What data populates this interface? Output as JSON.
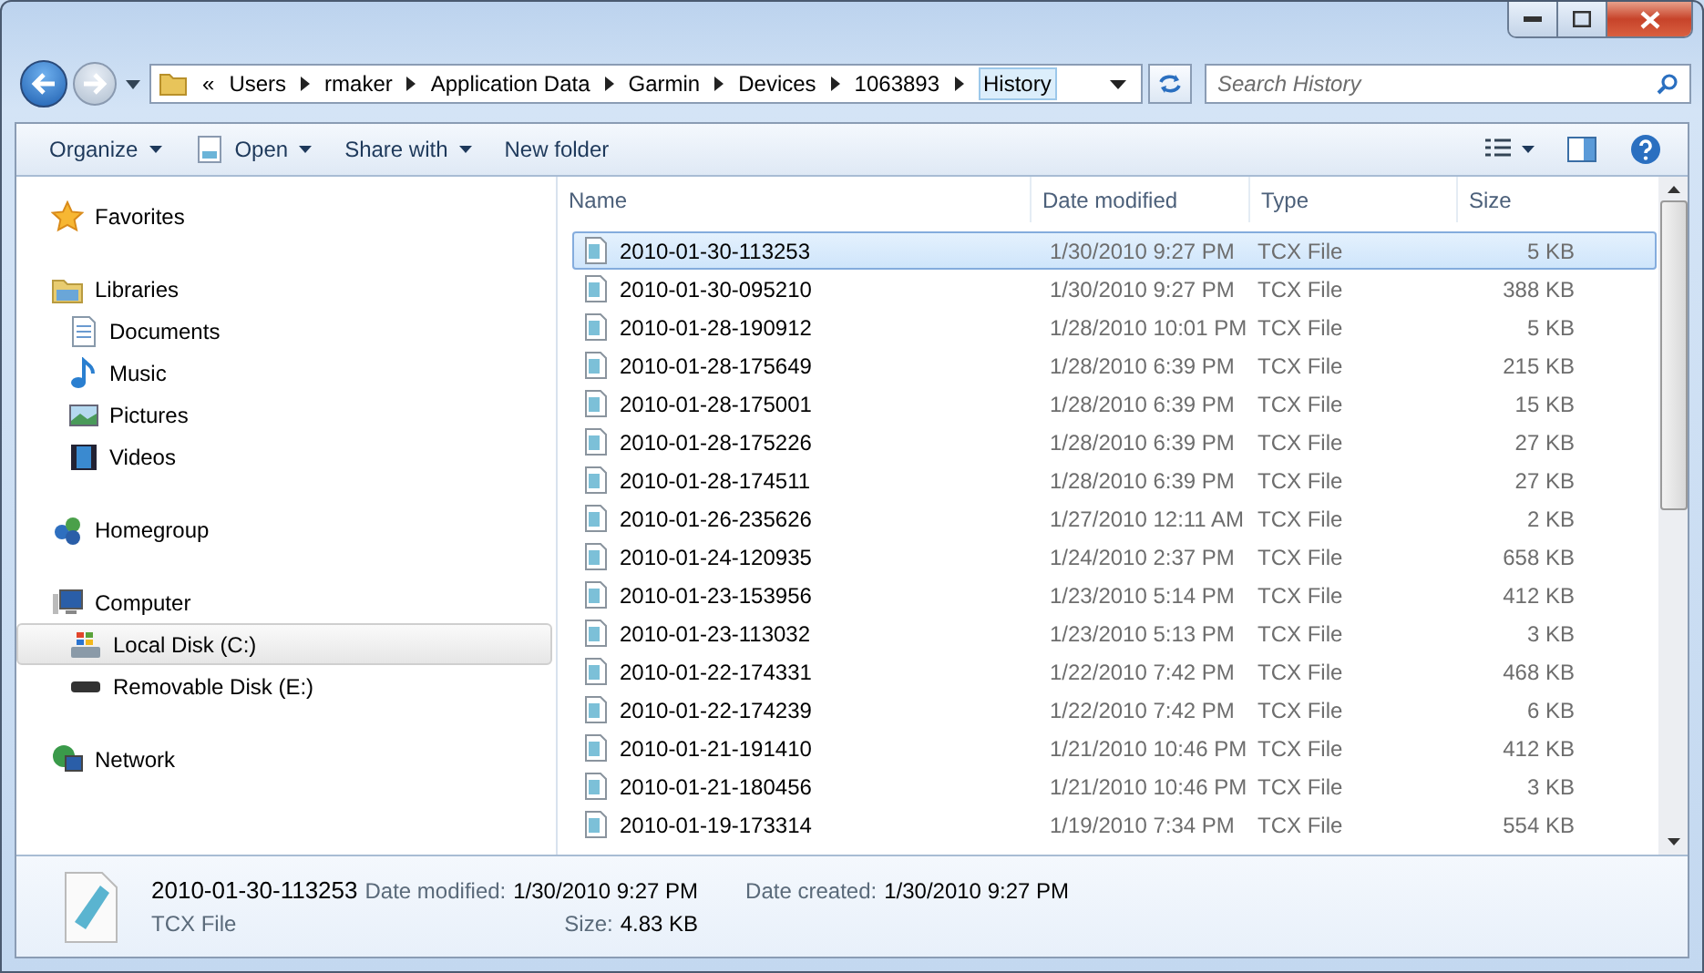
{
  "address": {
    "overflow": "«",
    "crumbs": [
      "Users",
      "rmaker",
      "Application Data",
      "Garmin",
      "Devices",
      "1063893",
      "History"
    ]
  },
  "search": {
    "placeholder": "Search History"
  },
  "toolbar": [
    "Organize",
    "Open",
    "Share with",
    "New folder"
  ],
  "sidebar": [
    {
      "kind": "favorites",
      "label": "Favorites",
      "selected": false
    },
    {
      "kind": "libraries",
      "label": "Libraries",
      "selected": false,
      "children": [
        {
          "kind": "documents",
          "label": "Documents",
          "selected": false
        },
        {
          "kind": "music",
          "label": "Music",
          "selected": false
        },
        {
          "kind": "pictures",
          "label": "Pictures",
          "selected": false
        },
        {
          "kind": "videos",
          "label": "Videos",
          "selected": false
        }
      ]
    },
    {
      "kind": "homegroup",
      "label": "Homegroup",
      "selected": false
    },
    {
      "kind": "computer",
      "label": "Computer",
      "selected": false,
      "children": [
        {
          "kind": "localdisk",
          "label": "Local Disk (C:)",
          "selected": true
        },
        {
          "kind": "removable",
          "label": "Removable Disk (E:)",
          "selected": false
        }
      ]
    },
    {
      "kind": "network",
      "label": "Network",
      "selected": false
    }
  ],
  "table": {
    "columns": [
      "Name",
      "Date modified",
      "Type",
      "Size"
    ],
    "rows": [
      {
        "name": "2010-01-30-113253",
        "date": "1/30/2010 9:27 PM",
        "type": "TCX File",
        "size": "5 KB",
        "selected": true
      },
      {
        "name": "2010-01-30-095210",
        "date": "1/30/2010 9:27 PM",
        "type": "TCX File",
        "size": "388 KB",
        "selected": false
      },
      {
        "name": "2010-01-28-190912",
        "date": "1/28/2010 10:01 PM",
        "type": "TCX File",
        "size": "5 KB",
        "selected": false
      },
      {
        "name": "2010-01-28-175649",
        "date": "1/28/2010 6:39 PM",
        "type": "TCX File",
        "size": "215 KB",
        "selected": false
      },
      {
        "name": "2010-01-28-175001",
        "date": "1/28/2010 6:39 PM",
        "type": "TCX File",
        "size": "15 KB",
        "selected": false
      },
      {
        "name": "2010-01-28-175226",
        "date": "1/28/2010 6:39 PM",
        "type": "TCX File",
        "size": "27 KB",
        "selected": false
      },
      {
        "name": "2010-01-28-174511",
        "date": "1/28/2010 6:39 PM",
        "type": "TCX File",
        "size": "27 KB",
        "selected": false
      },
      {
        "name": "2010-01-26-235626",
        "date": "1/27/2010 12:11 AM",
        "type": "TCX File",
        "size": "2 KB",
        "selected": false
      },
      {
        "name": "2010-01-24-120935",
        "date": "1/24/2010 2:37 PM",
        "type": "TCX File",
        "size": "658 KB",
        "selected": false
      },
      {
        "name": "2010-01-23-153956",
        "date": "1/23/2010 5:14 PM",
        "type": "TCX File",
        "size": "412 KB",
        "selected": false
      },
      {
        "name": "2010-01-23-113032",
        "date": "1/23/2010 5:13 PM",
        "type": "TCX File",
        "size": "3 KB",
        "selected": false
      },
      {
        "name": "2010-01-22-174331",
        "date": "1/22/2010 7:42 PM",
        "type": "TCX File",
        "size": "468 KB",
        "selected": false
      },
      {
        "name": "2010-01-22-174239",
        "date": "1/22/2010 7:42 PM",
        "type": "TCX File",
        "size": "6 KB",
        "selected": false
      },
      {
        "name": "2010-01-21-191410",
        "date": "1/21/2010 10:46 PM",
        "type": "TCX File",
        "size": "412 KB",
        "selected": false
      },
      {
        "name": "2010-01-21-180456",
        "date": "1/21/2010 10:46 PM",
        "type": "TCX File",
        "size": "3 KB",
        "selected": false
      },
      {
        "name": "2010-01-19-173314",
        "date": "1/19/2010 7:34 PM",
        "type": "TCX File",
        "size": "554 KB",
        "selected": false
      }
    ]
  },
  "details": {
    "name": "2010-01-30-113253",
    "type": "TCX File",
    "fields": [
      {
        "label": "Date modified:",
        "value": "1/30/2010 9:27 PM"
      },
      {
        "label": "Size:",
        "value": "4.83 KB"
      },
      {
        "label": "Date created:",
        "value": "1/30/2010 9:27 PM"
      }
    ]
  }
}
